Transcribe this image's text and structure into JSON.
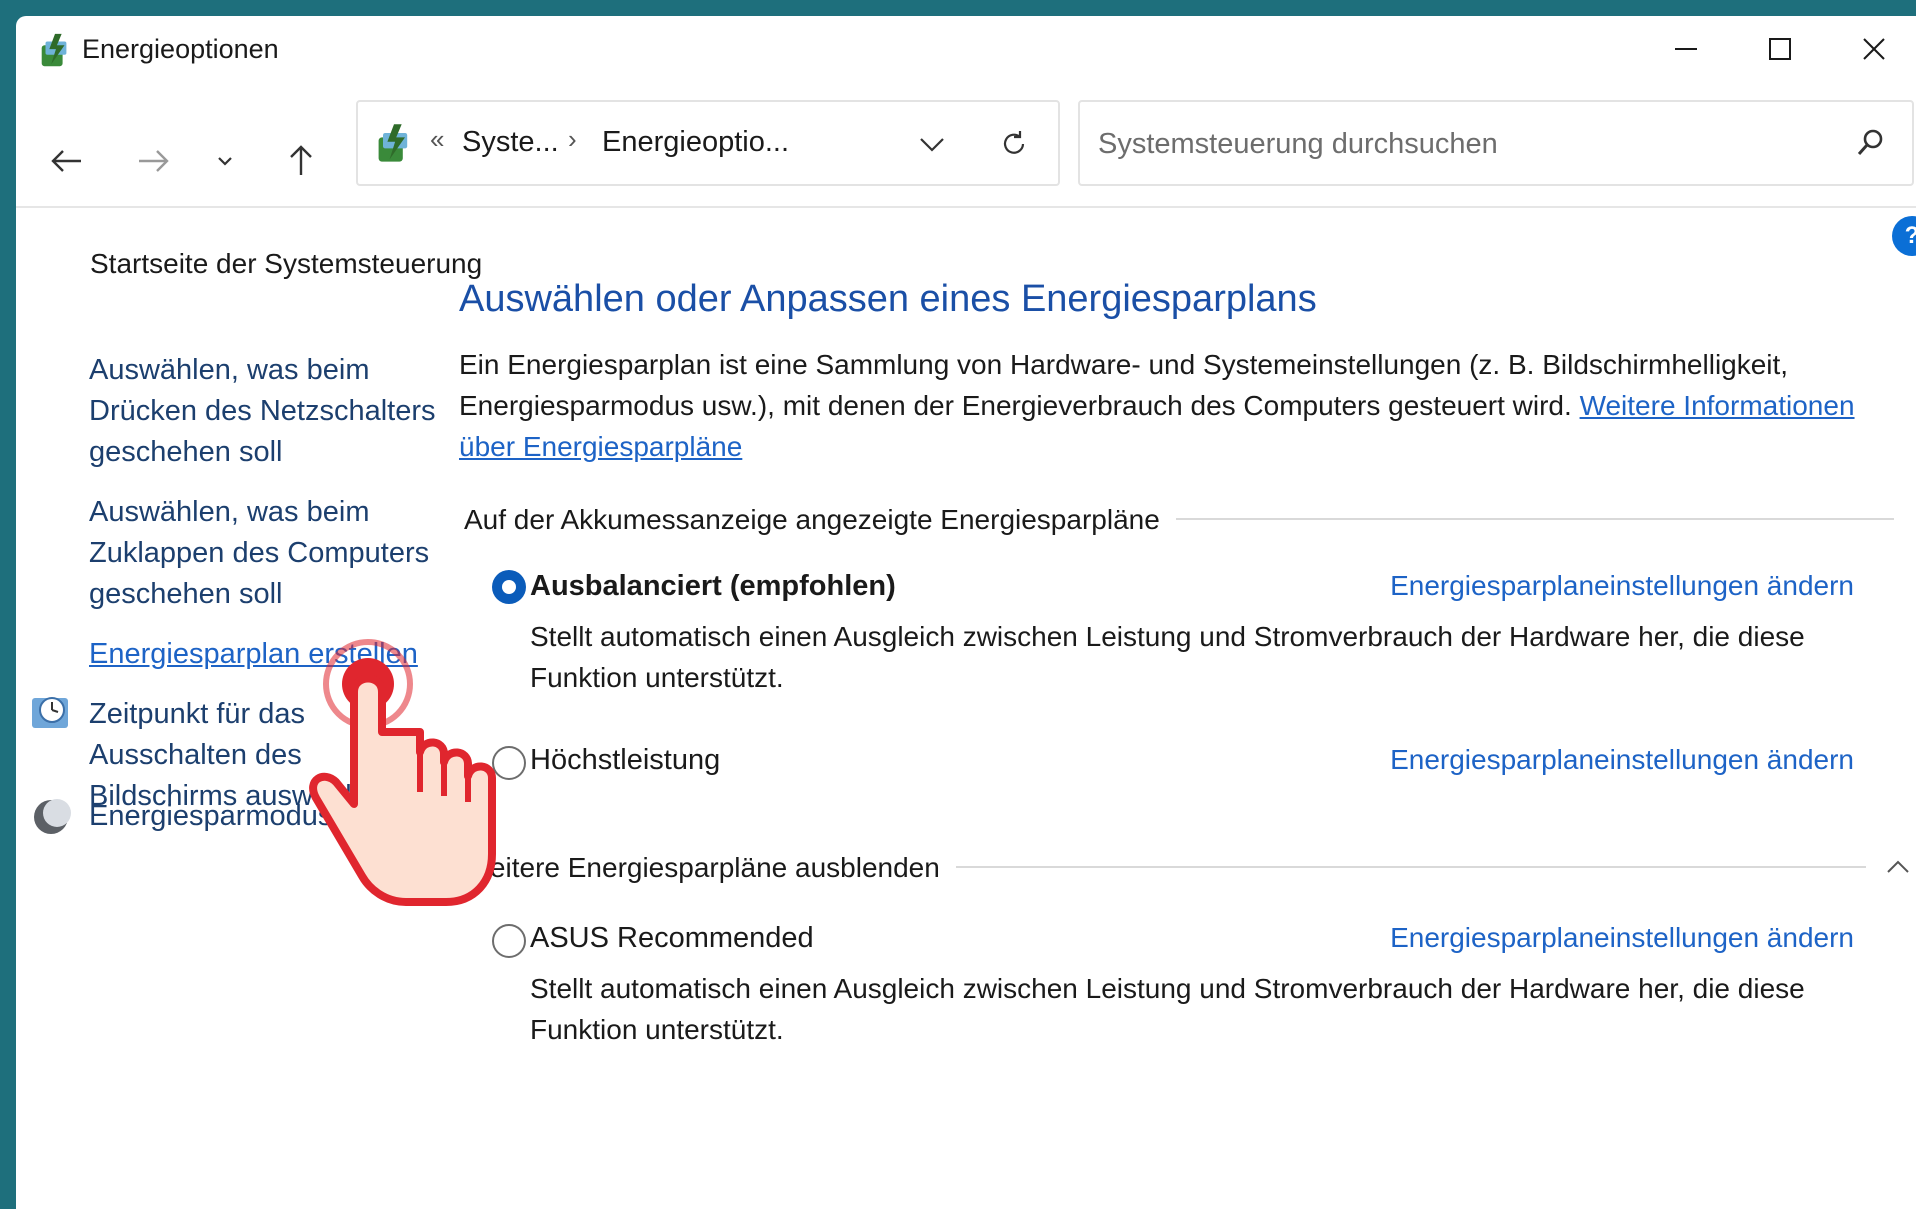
{
  "window": {
    "title": "Energieoptionen"
  },
  "address": {
    "overflow": "«",
    "crumbs": [
      "Syste...",
      "Energieoptio..."
    ],
    "separator": "›"
  },
  "search": {
    "placeholder": "Systemsteuerung durchsuchen"
  },
  "help": {
    "label": "?"
  },
  "sidebar": {
    "home": "Startseite der Systemsteuerung",
    "links": [
      "Auswählen, was beim Drücken des Netzschalters geschehen soll",
      "Auswählen, was beim Zuklappen des Computers geschehen soll",
      "Energiesparplan erstellen",
      "Zeitpunkt für das Ausschalten des Bildschirms auswählen",
      "Energiesparmodus ändern"
    ]
  },
  "main": {
    "heading": "Auswählen oder Anpassen eines Energiesparplans",
    "intro": "Ein Energiesparplan ist eine Sammlung von Hardware- und Systemeinstellungen (z. B. Bildschirmhelligkeit, Energiesparmodus usw.), mit denen der Energieverbrauch des Computers gesteuert wird.",
    "intro_link": "Weitere Informationen über Energiesparpläne",
    "group1_title": "Auf der Akkumessanzeige angezeigte Energiesparpläne",
    "group2_title": "Weitere Energiesparpläne ausblenden",
    "plan_link": "Energiesparplaneinstellungen ändern",
    "plans": [
      {
        "name": "Ausbalanciert (empfohlen)",
        "selected": true,
        "desc": "Stellt automatisch einen Ausgleich zwischen Leistung und Stromverbrauch der Hardware her, die diese Funktion unterstützt."
      },
      {
        "name": "Höchstleistung",
        "selected": false,
        "desc": ""
      },
      {
        "name": "ASUS Recommended",
        "selected": false,
        "desc": "Stellt automatisch einen Ausgleich zwischen Leistung und Stromverbrauch der Hardware her, die diese Funktion unterstützt."
      }
    ]
  },
  "colors": {
    "accent": "#1d63c6",
    "heading": "#1a4fa6",
    "pointer_red": "#e0262e"
  },
  "icons": [
    "power-options-icon",
    "back-arrow-icon",
    "forward-arrow-icon",
    "recent-chevron-icon",
    "up-arrow-icon",
    "refresh-icon",
    "search-icon",
    "clock-icon",
    "moon-icon",
    "collapse-chevron-icon",
    "pointer-hand-icon"
  ]
}
